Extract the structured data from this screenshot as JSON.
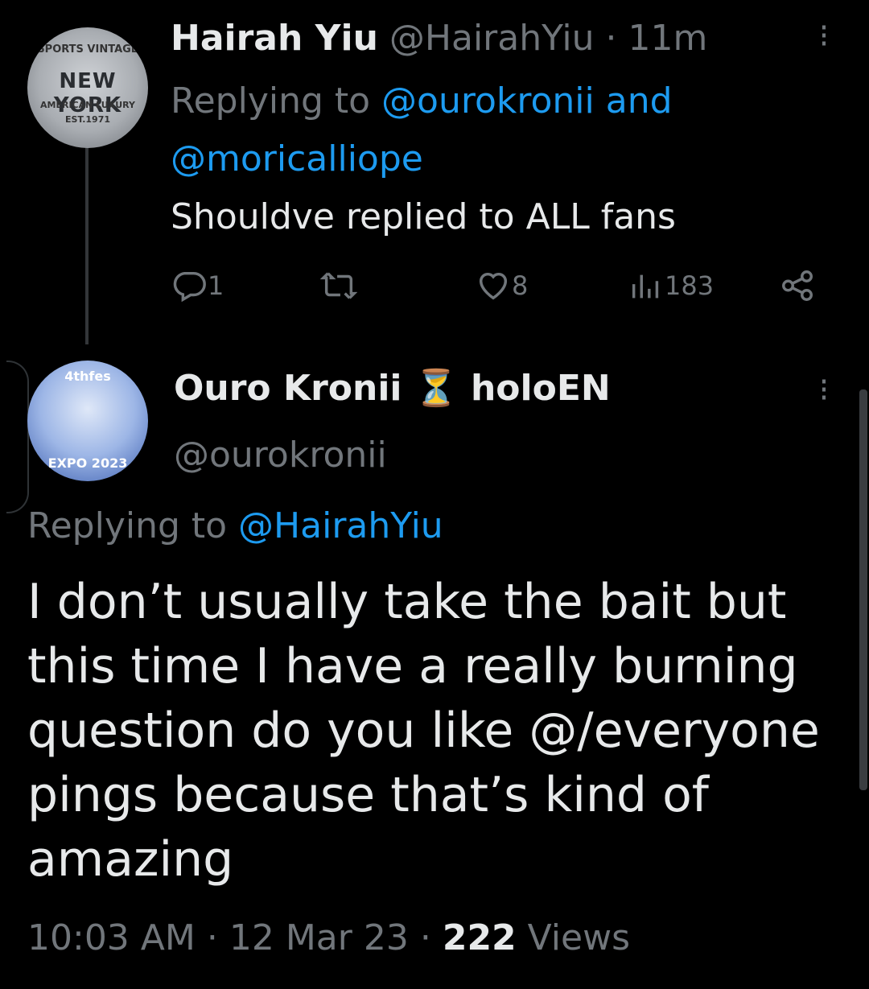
{
  "thread": {
    "parent": {
      "name": "Hairah Yiu",
      "handle": "@HairahYiu",
      "separator": "·",
      "time": "11m",
      "replying_prefix": "Replying to ",
      "replying_to_1": "@ourokronii",
      "replying_and": " and",
      "replying_to_2": "@moricalliope",
      "body": "Shouldve replied to ALL fans",
      "actions": {
        "replies": "1",
        "retweets": "",
        "likes": "8",
        "views": "183"
      },
      "avatar_lines": [
        "SPORTS VINTAGE",
        "NEW YORK",
        "AMERICAN LUXURY",
        "EST.1971"
      ]
    },
    "reply": {
      "name": "Ouro Kronii",
      "emoji": "⏳",
      "name_suffix": "holoEN",
      "handle": "@ourokronii",
      "replying_prefix": "Replying to ",
      "replying_to": "@HairahYiu",
      "body": "I don’t usually take the bait but this time I have a really burning question do you like @/everyone pings because that’s kind of amazing",
      "time": "10:03 AM",
      "sep": "·",
      "date": "12 Mar 23",
      "views_count": "222",
      "views_label": " Views",
      "avatar_lines": [
        "4thfes",
        "EXPO 2023"
      ]
    }
  },
  "colors": {
    "background": "#000000",
    "text": "#e7e9ea",
    "muted": "#71767b",
    "link": "#1d9bf0"
  },
  "icons": [
    "reply-icon",
    "retweet-icon",
    "like-icon",
    "views-icon",
    "share-icon",
    "more-icon"
  ]
}
